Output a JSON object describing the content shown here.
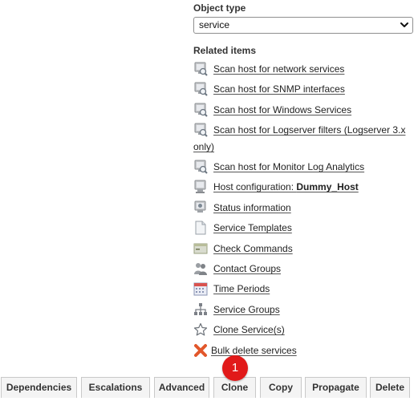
{
  "object_type": {
    "title": "Object type",
    "selected": "service"
  },
  "related": {
    "title": "Related items",
    "items": [
      {
        "icon": "scan-host-icon",
        "label": "Scan host for network services"
      },
      {
        "icon": "scan-host-icon",
        "label": "Scan host for SNMP interfaces"
      },
      {
        "icon": "scan-host-icon",
        "label": "Scan host for Windows Services"
      },
      {
        "icon": "scan-host-icon",
        "label": "Scan host for Logserver filters (Logserver 3.x only)"
      },
      {
        "icon": "scan-host-icon",
        "label": "Scan host for Monitor Log Analytics"
      },
      {
        "icon": "host-config-icon",
        "label_prefix": "Host configuration: ",
        "label_bold": "Dummy_Host"
      },
      {
        "icon": "status-info-icon",
        "label": "Status information"
      },
      {
        "icon": "document-icon",
        "label": "Service Templates"
      },
      {
        "icon": "terminal-icon",
        "label": "Check Commands"
      },
      {
        "icon": "contact-groups-icon",
        "label": "Contact Groups"
      },
      {
        "icon": "calendar-icon",
        "label": "Time Periods"
      },
      {
        "icon": "hierarchy-icon",
        "label": "Service Groups"
      },
      {
        "icon": "star-icon",
        "label": "Clone Service(s)"
      },
      {
        "icon": "delete-x-icon",
        "label": "Bulk delete services"
      }
    ]
  },
  "tabs": [
    "Dependencies",
    "Escalations",
    "Advanced",
    "Clone",
    "Copy",
    "Propagate",
    "Delete"
  ],
  "badge": "1",
  "colors": {
    "badge": "#e11a1a",
    "delete_icon": "#e2572b",
    "tab_bg": "#f4f4f4"
  }
}
